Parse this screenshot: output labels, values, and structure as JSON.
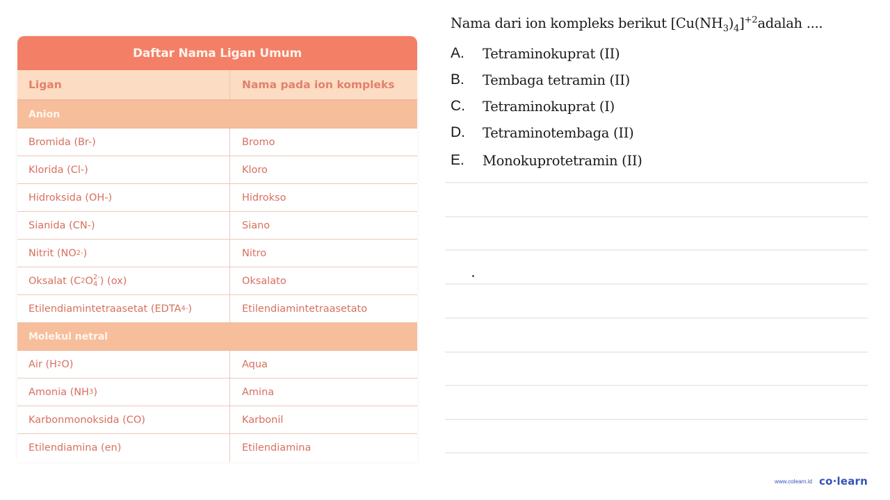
{
  "table": {
    "title": "Daftar Nama Ligan Umum",
    "headers": {
      "ligand": "Ligan",
      "name": "Nama pada ion kompleks"
    },
    "sections": [
      {
        "label": "Anion",
        "rows": [
          {
            "ligand_pre": "Bromida (Br-)",
            "name": "Bromo"
          },
          {
            "ligand_pre": "Klorida (Cl-)",
            "name": "Kloro"
          },
          {
            "ligand_pre": "Hidroksida (OH-)",
            "name": "Hidrokso"
          },
          {
            "ligand_pre": "Sianida (CN-)",
            "name": "Siano"
          },
          {
            "ligand_pre": "Nitrit (NO",
            "ligand_sub": "2-",
            "ligand_post": ")",
            "name": "Nitro"
          },
          {
            "ligand_pre": "Oksalat (C",
            "ligand_sub": "2",
            "ligand_mid": "O",
            "ligand_sub2": "4",
            "ligand_sup": "2-",
            "ligand_post": " ) (ox)",
            "name": "Oksalato"
          },
          {
            "ligand_pre": "Etilendiamintetraasetat (EDTA ",
            "ligand_sup": "4-",
            "ligand_post": " )",
            "name": "Etilendiamintetraasetato"
          }
        ]
      },
      {
        "label": "Molekul netral",
        "rows": [
          {
            "ligand_pre": "Air (H",
            "ligand_sub": "2",
            "ligand_post": "O)",
            "name": "Aqua"
          },
          {
            "ligand_pre": "Amonia (NH",
            "ligand_sub": "3",
            "ligand_post": ")",
            "name": "Amina"
          },
          {
            "ligand_pre": "Karbonmonoksida (CO)",
            "name": "Karbonil"
          },
          {
            "ligand_pre": "Etilendiamina (en)",
            "name": "Etilendiamina"
          }
        ]
      }
    ]
  },
  "question": {
    "prefix": "Nama dari ion kompleks berikut [Cu(NH",
    "sub1": "3",
    "mid": ")",
    "sub2": "4",
    "close": "]",
    "sup": "+2",
    "suffix": "adalah ...."
  },
  "options": [
    {
      "letter": "A.",
      "text": "Tetraminokuprat (II)"
    },
    {
      "letter": "B.",
      "text": "Tembaga tetramin (II)"
    },
    {
      "letter": "C.",
      "text": "Tetraminokuprat (I)"
    },
    {
      "letter": "D.",
      "text": "Tetraminotembaga (II)"
    },
    {
      "letter": "E.",
      "text": "Monokuprotetramin (II)"
    }
  ],
  "brand": {
    "url": "www.colearn.id",
    "logo": "co·learn"
  },
  "colors": {
    "title_bar": "#F37F66",
    "header_row": "#FCDCC2",
    "section_row": "#F7BE9C",
    "cell_text": "#D86F5E",
    "brand": "#3552B8"
  }
}
